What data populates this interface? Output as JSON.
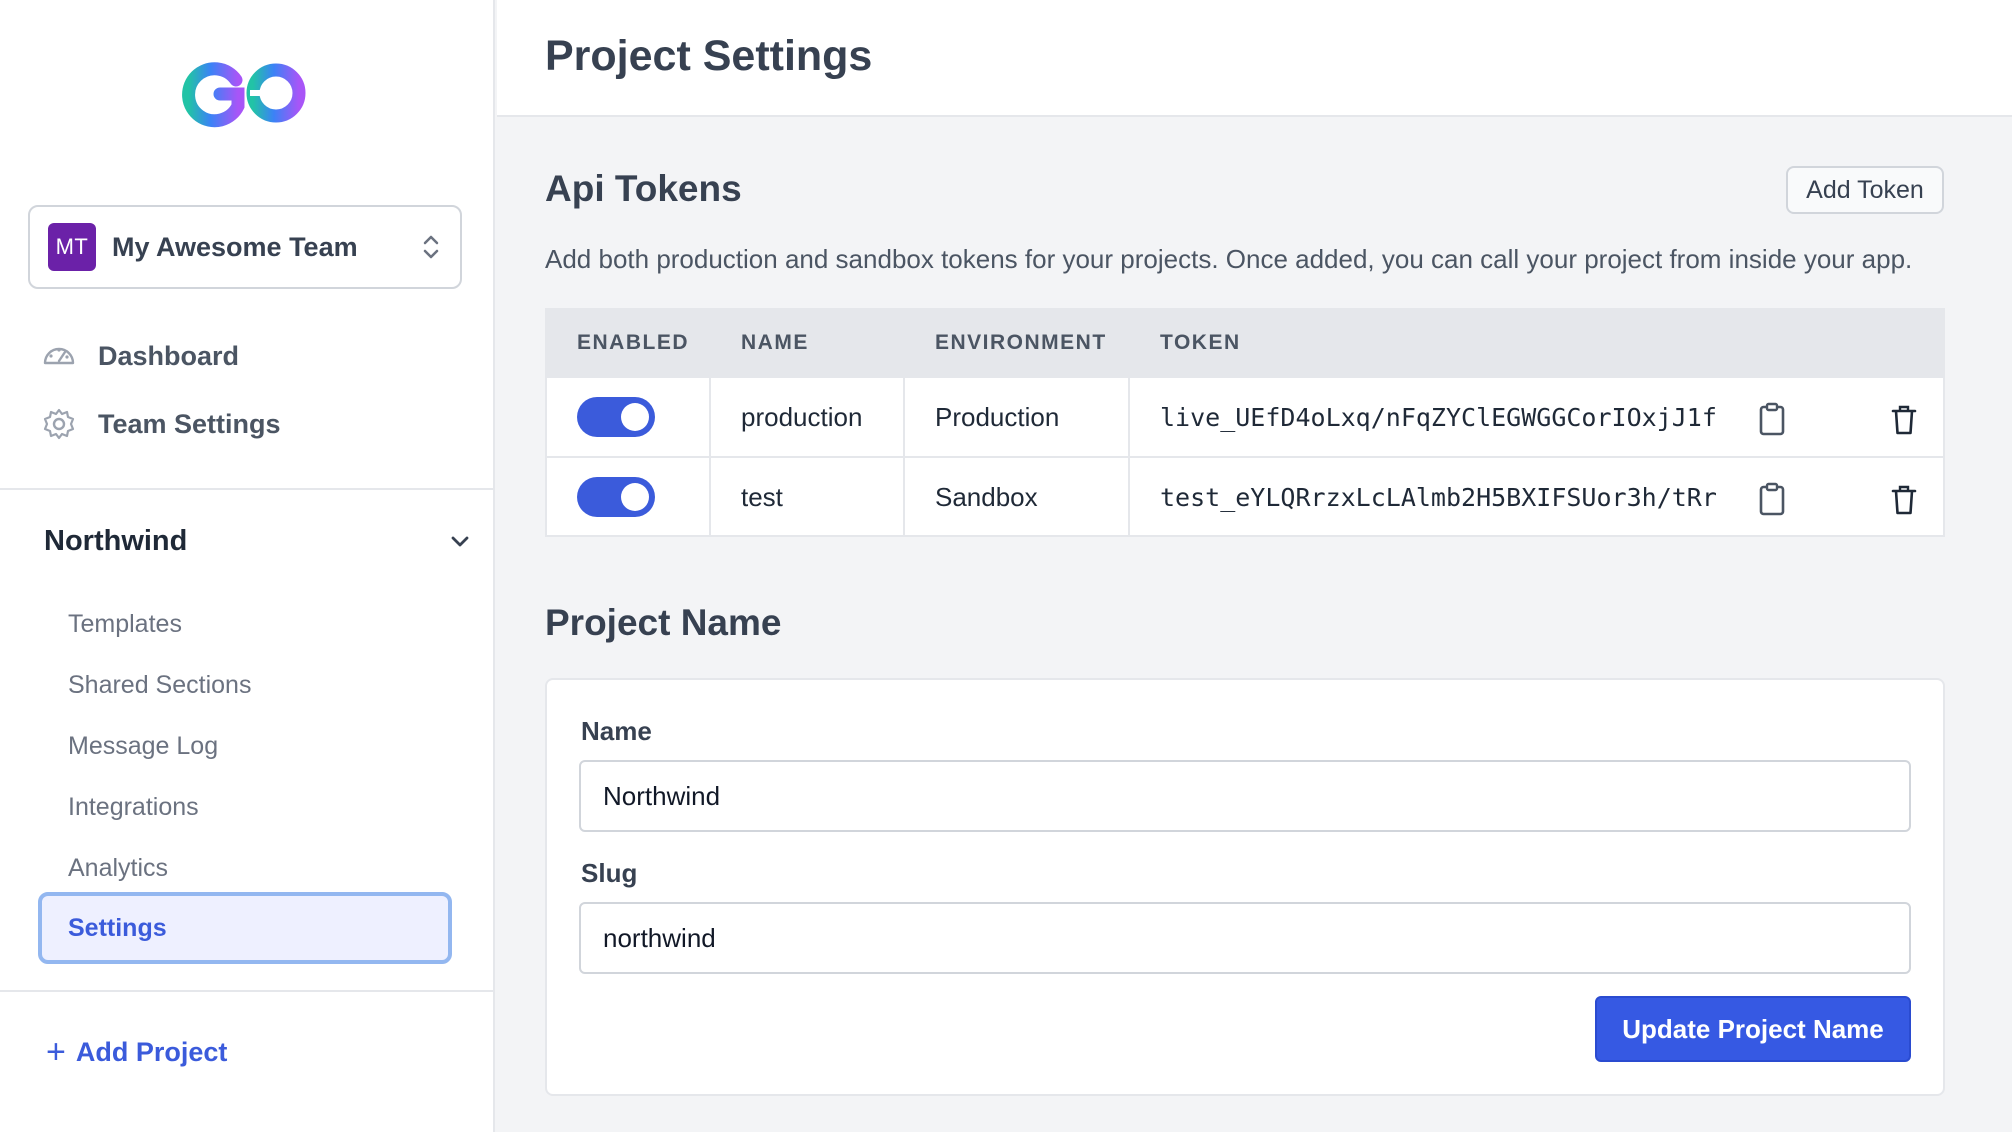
{
  "sidebar": {
    "team": {
      "initials": "MT",
      "name": "My Awesome Team"
    },
    "nav": [
      {
        "label": "Dashboard",
        "icon": "dashboard-gauge-icon"
      },
      {
        "label": "Team Settings",
        "icon": "gear-icon"
      }
    ],
    "project": {
      "name": "Northwind",
      "items": [
        "Templates",
        "Shared Sections",
        "Message Log",
        "Integrations",
        "Analytics"
      ],
      "active_item": "Settings"
    },
    "add_project_label": "Add Project"
  },
  "header": {
    "title": "Project Settings"
  },
  "api_tokens": {
    "title": "Api Tokens",
    "add_button": "Add Token",
    "description": "Add both production and sandbox tokens for your projects. Once added, you can call your project from inside your app.",
    "columns": [
      "ENABLED",
      "NAME",
      "ENVIRONMENT",
      "TOKEN"
    ],
    "rows": [
      {
        "enabled": true,
        "name": "production",
        "environment": "Production",
        "token": "live_UEfD4oLxq/nFqZYClEGWGGCorIOxjJ1f"
      },
      {
        "enabled": true,
        "name": "test",
        "environment": "Sandbox",
        "token": "test_eYLQRrzxLcLAlmb2H5BXIFSUor3h/tRr"
      }
    ]
  },
  "project_name": {
    "title": "Project Name",
    "name_label": "Name",
    "name_value": "Northwind",
    "slug_label": "Slug",
    "slug_value": "northwind",
    "submit_label": "Update Project Name"
  },
  "colors": {
    "accent": "#3b5bdb",
    "team_avatar": "#6b21a8",
    "active_bg": "#eef0ff"
  }
}
